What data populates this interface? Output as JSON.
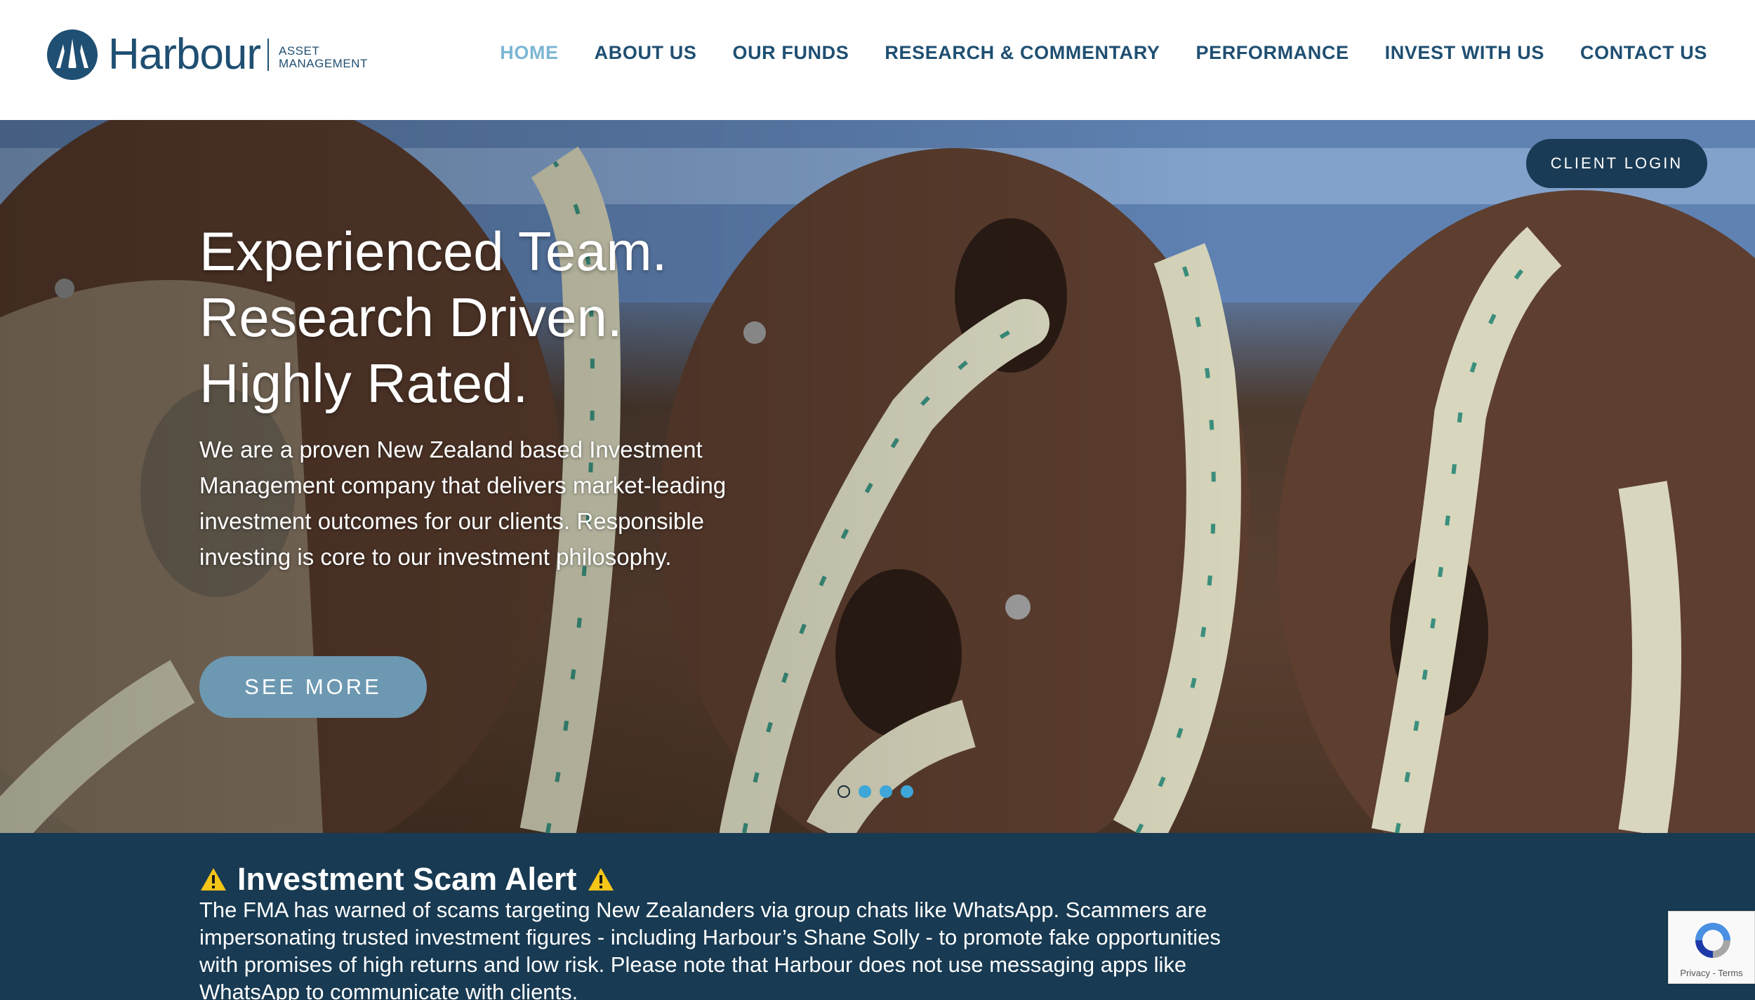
{
  "header": {
    "logo": {
      "wordmark": "Harbour",
      "sub_line1": "ASSET",
      "sub_line2": "MANAGEMENT"
    },
    "nav": [
      {
        "label": "HOME",
        "active": true
      },
      {
        "label": "ABOUT US"
      },
      {
        "label": "OUR FUNDS"
      },
      {
        "label": "RESEARCH & COMMENTARY"
      },
      {
        "label": "PERFORMANCE"
      },
      {
        "label": "INVEST WITH US"
      },
      {
        "label": "CONTACT US"
      }
    ]
  },
  "hero": {
    "client_login": "CLIENT LOGIN",
    "headline": [
      "Experienced Team.",
      "Research Driven.",
      "Highly Rated."
    ],
    "body": "We are a proven New Zealand based Investment Management company that delivers market-leading investment outcomes for our clients. Responsible investing is core to our investment philosophy.",
    "cta": "SEE MORE",
    "carousel": {
      "slide_count": 4,
      "active_index": 0
    }
  },
  "alert": {
    "title": "Investment Scam Alert",
    "body": "The FMA has warned of scams targeting New Zealanders via group chats like WhatsApp. Scammers are impersonating trusted investment figures - including Harbour’s Shane Solly - to promote fake opportunities with promises of high returns and low risk. Please note that Harbour does not use messaging apps like WhatsApp to communicate with clients."
  },
  "recaptcha": {
    "links": "Privacy - Terms"
  },
  "colors": {
    "brand_navy": "#1f4f72",
    "nav_active": "#7cb6d4",
    "alert_bg": "#183a52",
    "cta_bg": "#6d98b1",
    "login_bg": "#1a3b55",
    "dot": "#3ea6d8",
    "warning": "#f5c518"
  },
  "icons": {
    "logo_mark": "sails-circle-icon",
    "alert_icon": "warning-triangle-icon",
    "recaptcha": "recaptcha-icon"
  }
}
